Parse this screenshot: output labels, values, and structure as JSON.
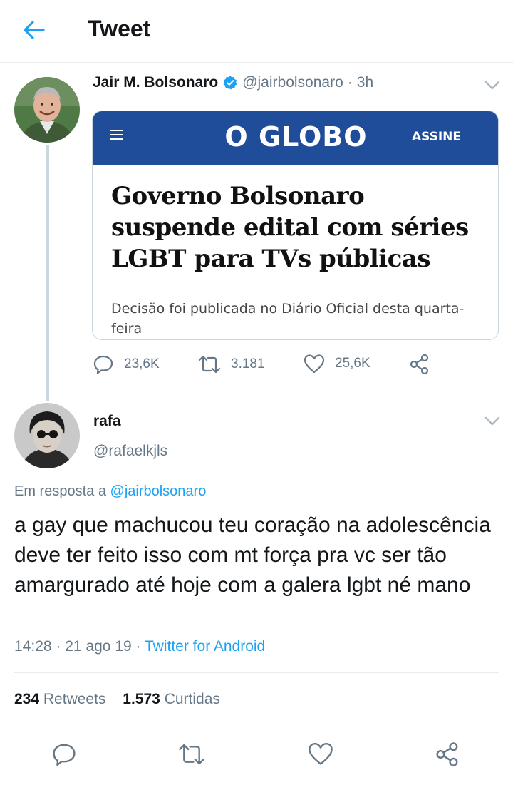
{
  "header": {
    "title": "Tweet",
    "back_icon": "arrow-left-icon",
    "accent": "#1da1f2"
  },
  "tweet1": {
    "name": "Jair M. Bolsonaro",
    "handle": "@jairbolsonaro",
    "dot": "·",
    "time": "3h",
    "verified_icon": "verified-badge-icon",
    "card": {
      "logo": "O GLOBO",
      "assine": "ASSINE",
      "headline": "Governo Bolsonaro suspende edital com séries LGBT para TVs públicas",
      "subtitle": "Decisão foi publicada no Diário Oficial desta quarta-feira",
      "band_color": "#1f4d99"
    },
    "actions": {
      "replies": "23,6K",
      "retweets": "3.181",
      "likes": "25,6K"
    }
  },
  "tweet2": {
    "name": "rafa",
    "handle": "@rafaelkjls",
    "reply_prefix": "Em resposta a",
    "reply_to": "@jairbolsonaro",
    "text": "a gay que machucou teu coração na adolescência  deve ter feito isso com mt força pra vc ser tão amargurado até hoje com a galera lgbt né mano",
    "time": "14:28",
    "date": "21 ago 19",
    "source": "Twitter for Android",
    "dot": "·"
  },
  "stats": {
    "retweets_count": "234",
    "retweets_label": "Retweets",
    "likes_count": "1.573",
    "likes_label": "Curtidas"
  }
}
